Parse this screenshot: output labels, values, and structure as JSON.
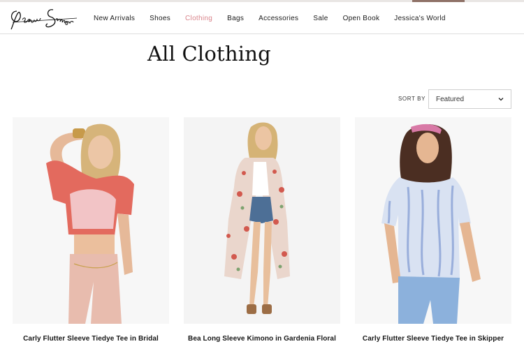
{
  "brand": {
    "logo_text": "Jessica Simpson"
  },
  "nav": {
    "items": [
      {
        "label": "New Arrivals"
      },
      {
        "label": "Shoes"
      },
      {
        "label": "Clothing"
      },
      {
        "label": "Bags"
      },
      {
        "label": "Accessories"
      },
      {
        "label": "Sale"
      },
      {
        "label": "Open Book"
      },
      {
        "label": "Jessica's World"
      }
    ],
    "active": "Clothing",
    "active_color": "#d9848b"
  },
  "page": {
    "title": "All Clothing"
  },
  "sort": {
    "label": "SORT BY",
    "selected": "Featured",
    "icon": "chevron-down-icon"
  },
  "products": [
    {
      "name": "Carly Flutter Sleeve Tiedye Tee in Bridal",
      "top_color": "#e3635a"
    },
    {
      "name": "Bea Long Sleeve Kimono in Gardenia Floral",
      "top_color": "#d97a6e"
    },
    {
      "name": "Carly Flutter Sleeve Tiedye Tee in Skipper",
      "top_color": "#9bb3dd"
    }
  ]
}
